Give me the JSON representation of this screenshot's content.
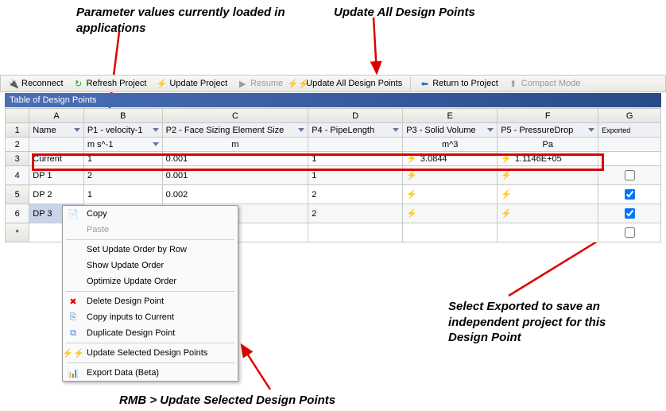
{
  "annotations": {
    "a1": "Parameter values currently loaded in applications",
    "a2": "Update All Design Points",
    "a3": "Select Exported to save an independent project for this Design Point",
    "a4": "RMB > Update Selected Design Points"
  },
  "toolbar": {
    "reconnect": "Reconnect",
    "refresh": "Refresh Project",
    "update": "Update Project",
    "resume": "Resume",
    "update_all": "Update All Design Points",
    "return": "Return to Project",
    "compact": "Compact Mode"
  },
  "title": "Table of Design Points",
  "columns": {
    "A": "A",
    "B": "B",
    "C": "C",
    "D": "D",
    "E": "E",
    "F": "F",
    "G": "G"
  },
  "param_row": {
    "name": "Name",
    "p1": "P1 - velocity-1",
    "p2": "P2 - Face Sizing Element Size",
    "p4": "P4 - PipeLength",
    "p3": "P3 - Solid Volume",
    "p5": "P5 - PressureDrop",
    "exported": "Exported"
  },
  "units_row": {
    "b": "m s^-1",
    "c": "m",
    "e": "m^3",
    "f": "Pa"
  },
  "rows": [
    {
      "num": "3",
      "name": "Current",
      "b": "1",
      "c": "0.001",
      "d": "1",
      "e": "3.0844",
      "f": "1.1146E+05",
      "exp": null,
      "thunderE": true,
      "thunderF": true
    },
    {
      "num": "4",
      "name": "DP 1",
      "b": "2",
      "c": "0.001",
      "d": "1",
      "e": "",
      "f": "",
      "exp": false,
      "thunderE": true,
      "thunderF": true
    },
    {
      "num": "5",
      "name": "DP 2",
      "b": "1",
      "c": "0.002",
      "d": "2",
      "e": "",
      "f": "",
      "exp": true,
      "thunderE": true,
      "thunderF": true
    },
    {
      "num": "6",
      "name": "DP 3",
      "b": "",
      "c": "",
      "d": "2",
      "e": "",
      "f": "",
      "exp": true,
      "thunderE": true,
      "thunderF": true,
      "selected": true
    },
    {
      "num": "*",
      "name": "",
      "b": "",
      "c": "",
      "d": "",
      "e": "",
      "f": "",
      "exp": false,
      "thunderE": false,
      "thunderF": false
    }
  ],
  "context_menu": {
    "copy": "Copy",
    "paste": "Paste",
    "set_order": "Set Update Order by Row",
    "show_order": "Show Update Order",
    "optimize": "Optimize Update Order",
    "delete": "Delete Design Point",
    "copy_inputs": "Copy inputs to Current",
    "duplicate": "Duplicate Design Point",
    "update_sel": "Update Selected Design Points",
    "export": "Export Data (Beta)"
  },
  "row_labels": {
    "r1": "1",
    "r2": "2"
  }
}
